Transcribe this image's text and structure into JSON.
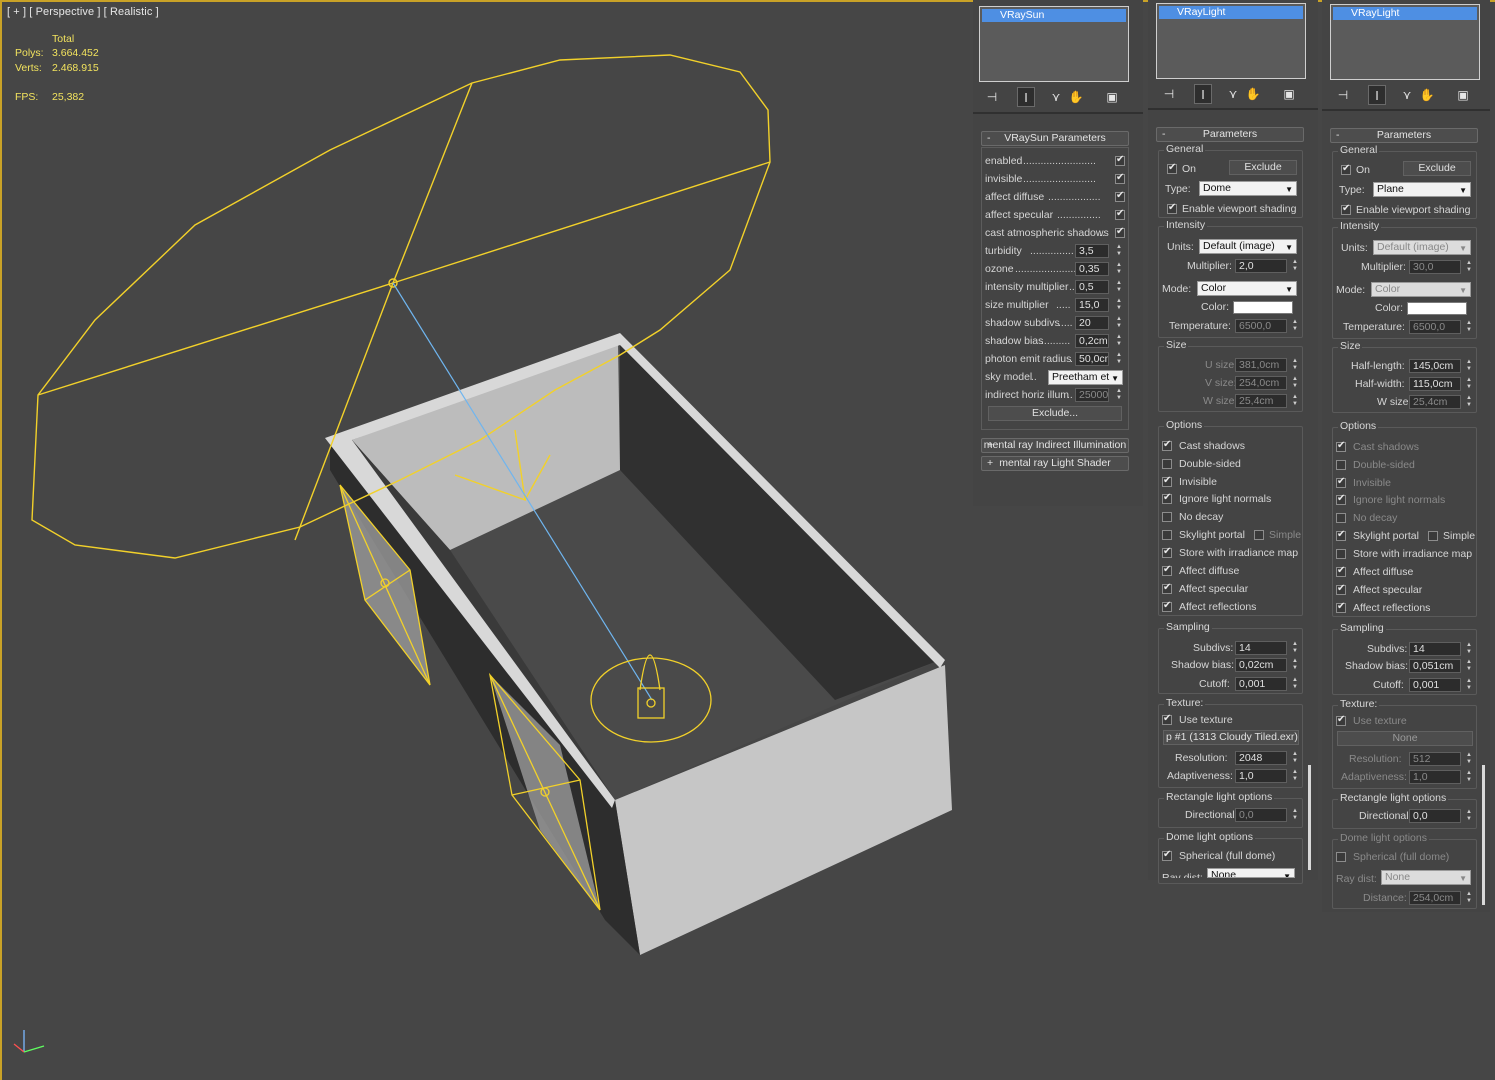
{
  "viewport": {
    "label": "[ + ] [ Perspective ] [ Realistic ]",
    "stats": {
      "total": "Total",
      "polys_label": "Polys:",
      "polys": "3.664.452",
      "verts_label": "Verts:",
      "verts": "2.468.915",
      "fps_label": "FPS:",
      "fps": "25,382"
    },
    "colors": {
      "background": "#464646",
      "helper": "#f2d12a",
      "target_line": "#6fb5ef",
      "wall": "#c4c4c4"
    }
  },
  "vraysun_panel": {
    "list_selected": "VRaySun",
    "tab_icons": [
      "pin-icon",
      "modify-icon",
      "hierarchy-icon",
      "motion-icon",
      "display-icon"
    ],
    "rollout_title": "VRaySun Parameters",
    "params": [
      {
        "label": "enabled",
        "checked": true
      },
      {
        "label": "invisible",
        "checked": true
      },
      {
        "label": "affect diffuse",
        "checked": true
      },
      {
        "label": "affect specular",
        "checked": true
      },
      {
        "label": "cast atmospheric shadows",
        "checked": true
      },
      {
        "label": "turbidity",
        "value": "3,5"
      },
      {
        "label": "ozone",
        "value": "0,35"
      },
      {
        "label": "intensity multiplier",
        "value": "0,5"
      },
      {
        "label": "size multiplier",
        "value": "15,0"
      },
      {
        "label": "shadow subdivs",
        "value": "20"
      },
      {
        "label": "shadow bias",
        "value": "0,2cm"
      },
      {
        "label": "photon emit radius",
        "value": "50,0cm"
      },
      {
        "label": "sky model",
        "dropdown": "Preetham et"
      },
      {
        "label": "indirect horiz illum",
        "value": "25000"
      }
    ],
    "exclude_button": "Exclude...",
    "closed_rollouts": [
      {
        "sign": "+",
        "title": "mental ray Indirect Illumination"
      },
      {
        "sign": "+",
        "title": "mental ray Light Shader"
      }
    ]
  },
  "vraylight_dome_panel": {
    "list_selected": "VRayLight",
    "rollout_title": "Parameters",
    "general": {
      "title": "General",
      "on_label": "On",
      "on": true,
      "exclude": "Exclude",
      "type_label": "Type:",
      "type": "Dome",
      "viewport_shading_label": "Enable viewport shading",
      "viewport_shading": true
    },
    "intensity": {
      "title": "Intensity",
      "units_label": "Units:",
      "units": "Default (image)",
      "multiplier_label": "Multiplier:",
      "multiplier": "2,0",
      "mode_label": "Mode:",
      "mode": "Color",
      "color_label": "Color:",
      "temperature_label": "Temperature:",
      "temperature": "6500,0"
    },
    "size": {
      "title": "Size",
      "u_label": "U size:",
      "u": "381,0cm",
      "v_label": "V size:",
      "v": "254,0cm",
      "w_label": "W size:",
      "w": "25,4cm"
    },
    "options": {
      "title": "Options",
      "items": [
        {
          "label": "Cast shadows",
          "checked": true
        },
        {
          "label": "Double-sided",
          "checked": false
        },
        {
          "label": "Invisible",
          "checked": true
        },
        {
          "label": "Ignore light normals",
          "checked": true
        },
        {
          "label": "No decay",
          "checked": false
        },
        {
          "label": "Skylight portal",
          "checked": false,
          "extra": "Simple",
          "extra_checked": false
        },
        {
          "label": "Store with irradiance map",
          "checked": true
        },
        {
          "label": "Affect diffuse",
          "checked": true
        },
        {
          "label": "Affect specular",
          "checked": true
        },
        {
          "label": "Affect reflections",
          "checked": true
        }
      ]
    },
    "sampling": {
      "title": "Sampling",
      "subdivs_label": "Subdivs:",
      "subdivs": "14",
      "shadow_bias_label": "Shadow bias:",
      "shadow_bias": "0,02cm",
      "cutoff_label": "Cutoff:",
      "cutoff": "0,001"
    },
    "texture": {
      "title": "Texture:",
      "use_texture_label": "Use texture",
      "use_texture": true,
      "map": "p #1 (1313 Cloudy Tiled.exr)",
      "resolution_label": "Resolution:",
      "resolution": "2048",
      "adaptiveness_label": "Adaptiveness:",
      "adaptiveness": "1,0"
    },
    "rect": {
      "title": "Rectangle light options",
      "directional_label": "Directional:",
      "directional": "0,0"
    },
    "dome": {
      "title": "Dome light options",
      "spherical_label": "Spherical (full dome)",
      "spherical": true,
      "ray_dist_label": "Ray dist:",
      "ray_dist": "None"
    }
  },
  "vraylight_plane_panel": {
    "list_selected": "VRayLight",
    "rollout_title": "Parameters",
    "general": {
      "title": "General",
      "on_label": "On",
      "on": true,
      "exclude": "Exclude",
      "type_label": "Type:",
      "type": "Plane",
      "viewport_shading_label": "Enable viewport shading",
      "viewport_shading": true
    },
    "intensity": {
      "title": "Intensity",
      "units_label": "Units:",
      "units": "Default (image)",
      "multiplier_label": "Multiplier:",
      "multiplier": "30,0",
      "mode_label": "Mode:",
      "mode": "Color",
      "color_label": "Color:",
      "temperature_label": "Temperature:",
      "temperature": "6500,0"
    },
    "size": {
      "title": "Size",
      "u_label": "Half-length:",
      "u": "145,0cm",
      "v_label": "Half-width:",
      "v": "115,0cm",
      "w_label": "W size",
      "w": "25,4cm"
    },
    "options": {
      "title": "Options",
      "items": [
        {
          "label": "Cast shadows",
          "checked": true
        },
        {
          "label": "Double-sided",
          "checked": false
        },
        {
          "label": "Invisible",
          "checked": true
        },
        {
          "label": "Ignore light normals",
          "checked": true
        },
        {
          "label": "No decay",
          "checked": false
        },
        {
          "label": "Skylight portal",
          "checked": true,
          "extra": "Simple",
          "extra_checked": false
        },
        {
          "label": "Store with irradiance map",
          "checked": false
        },
        {
          "label": "Affect diffuse",
          "checked": true
        },
        {
          "label": "Affect specular",
          "checked": true
        },
        {
          "label": "Affect reflections",
          "checked": true
        }
      ]
    },
    "sampling": {
      "title": "Sampling",
      "subdivs_label": "Subdivs:",
      "subdivs": "14",
      "shadow_bias_label": "Shadow bias:",
      "shadow_bias": "0,051cm",
      "cutoff_label": "Cutoff:",
      "cutoff": "0,001"
    },
    "texture": {
      "title": "Texture:",
      "use_texture_label": "Use texture",
      "use_texture": true,
      "map": "None",
      "resolution_label": "Resolution:",
      "resolution": "512",
      "adaptiveness_label": "Adaptiveness:",
      "adaptiveness": "1,0"
    },
    "rect": {
      "title": "Rectangle light options",
      "directional_label": "Directional:",
      "directional": "0,0"
    },
    "dome": {
      "title": "Dome light options",
      "spherical_label": "Spherical (full dome)",
      "spherical": false,
      "ray_dist_label": "Ray dist:",
      "ray_dist": "None",
      "distance_label": "Distance:",
      "distance": "254,0cm"
    }
  }
}
